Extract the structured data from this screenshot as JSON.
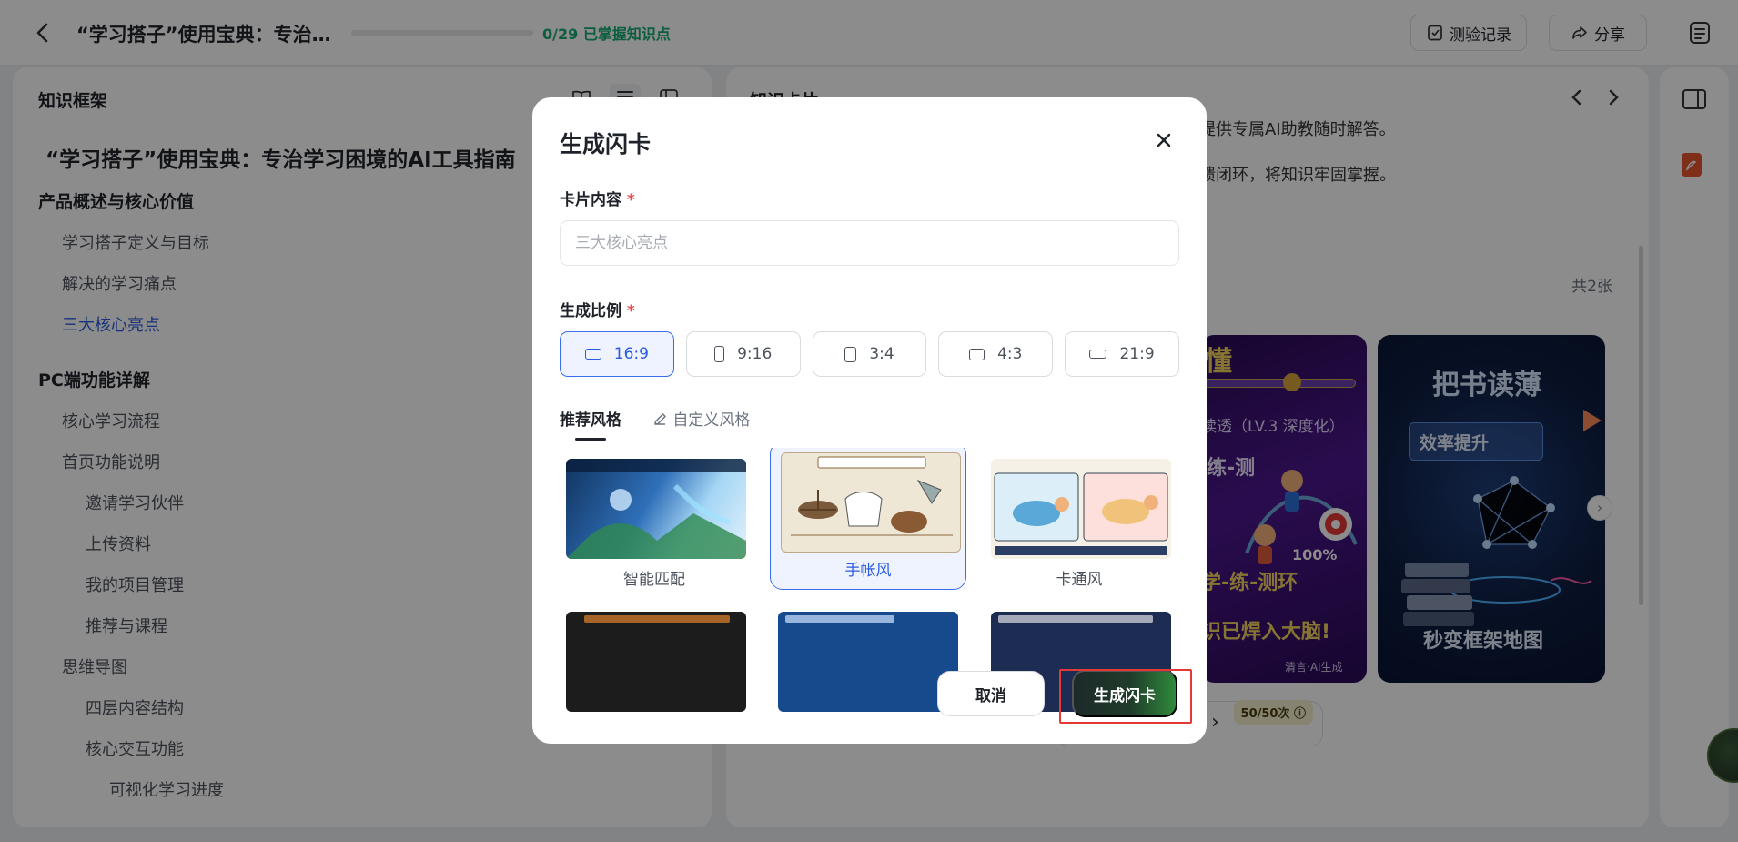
{
  "topbar": {
    "title": "“学习搭子”使用宝典：专治…",
    "progress_text": "0/29 已掌握知识点",
    "progress_fraction": 0.0,
    "quiz_record_label": "测验记录",
    "share_label": "分享"
  },
  "left_panel": {
    "heading": "知识框架",
    "book_title": "“学习搭子”使用宝典：专治学习困境的AI工具指南",
    "tree": [
      {
        "label": "产品概述与核心价值",
        "level": 0
      },
      {
        "label": "学习搭子定义与目标",
        "level": 1
      },
      {
        "label": "解决的学习痛点",
        "level": 1
      },
      {
        "label": "三大核心亮点",
        "level": 1,
        "active": true
      },
      {
        "label": "PC端功能详解",
        "level": 0
      },
      {
        "label": "核心学习流程",
        "level": 1
      },
      {
        "label": "首页功能说明",
        "level": 1
      },
      {
        "label": "邀请学习伙伴",
        "level": 2
      },
      {
        "label": "上传资料",
        "level": 2
      },
      {
        "label": "我的项目管理",
        "level": 2
      },
      {
        "label": "推荐与课程",
        "level": 2
      },
      {
        "label": "思维导图",
        "level": 1
      },
      {
        "label": "四层内容结构",
        "level": 2
      },
      {
        "label": "核心交互功能",
        "level": 2
      },
      {
        "label": "可视化学习进度",
        "level": 3
      }
    ]
  },
  "right_panel": {
    "heading": "知识卡片",
    "text_line1": "提供专属AI助教随时解答。",
    "text_line2": "馈闭环，将知识牢固掌握。",
    "count": "共2张",
    "card1_lines": [
      "懂",
      "读透（LV.3 深度化）",
      "练-测",
      "学-练-测环",
      "识已焊入大脑!",
      "100%",
      "清言·AI生成"
    ],
    "card2_lines": [
      "把书读薄",
      "效率提升",
      "秒变框架地图"
    ],
    "usage_badge": "50/50次 ⓘ"
  },
  "modal": {
    "title": "生成闪卡",
    "content_label": "卡片内容",
    "content_placeholder": "三大核心亮点",
    "ratio_label": "生成比例",
    "ratios": [
      "16:9",
      "9:16",
      "3:4",
      "4:3",
      "21:9"
    ],
    "selected_ratio": "16:9",
    "tab_recommended": "推荐风格",
    "tab_custom": "自定义风格",
    "styles": [
      "智能匹配",
      "手帐风",
      "卡通风"
    ],
    "selected_style": "手帐风",
    "cancel_label": "取消",
    "generate_label": "生成闪卡"
  },
  "colors": {
    "accent": "#2a5be0",
    "progress": "#19a974",
    "highlight": "#e53935"
  }
}
